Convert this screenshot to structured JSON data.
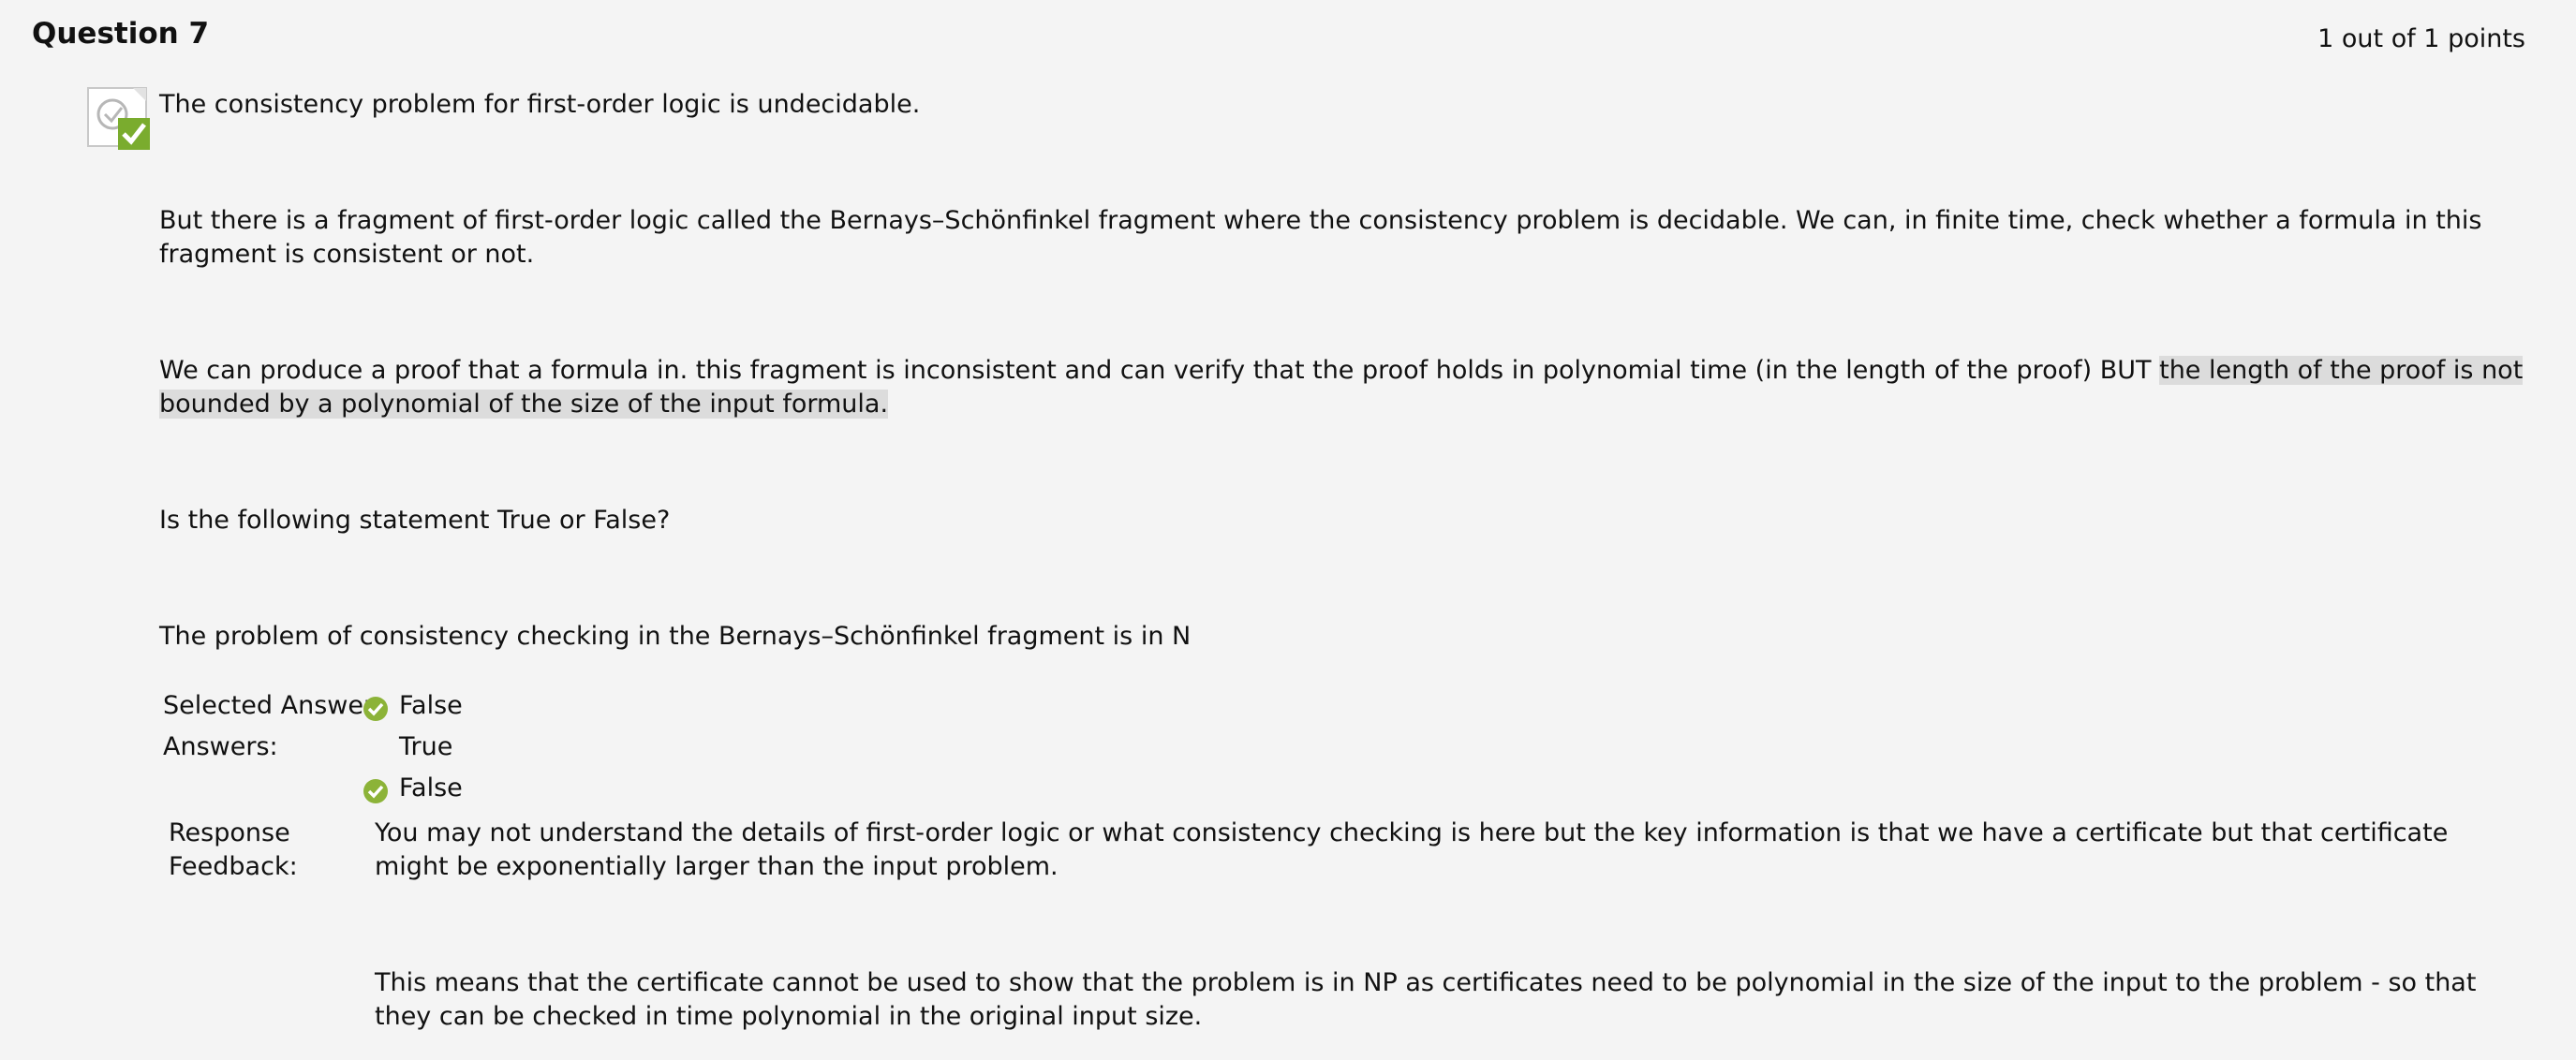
{
  "question": {
    "title": "Question 7",
    "points": "1 out of 1 points"
  },
  "body": {
    "p1": "The consistency problem for first-order logic is undecidable.",
    "p2": "But there is a fragment of first-order logic called the Bernays–Schönfinkel fragment where the consistency problem is decidable. We can, in finite time, check whether a formula in this fragment is consistent or not.",
    "p3_plain": "We can produce a proof that a formula in. this fragment is inconsistent and can verify that the proof holds in polynomial time (in the length of the proof) BUT ",
    "p3_highlight": "the length of the proof is not bounded by a polynomial of the size of the input formula.",
    "p4": "Is the following statement True or False?",
    "p5": "The problem of consistency checking in the Bernays–Schönfinkel fragment is in N"
  },
  "answers": {
    "selected_label": "Selected Answer:",
    "selected_value": "False",
    "answers_label": "Answers:",
    "options": [
      "True",
      "False"
    ]
  },
  "feedback": {
    "label": "Response Feedback:",
    "p1": "You may not understand the details of first-order logic or what consistency checking is here but the key information is that we have a certificate but that certificate might be exponentially larger than the input problem.",
    "p2": "This means that the certificate cannot be used to show that the problem is in NP as certificates need to be polynomial in the size of the input to the problem - so that they can be checked in time polynomial in the original input size."
  },
  "colors": {
    "background": "#f4f4f4",
    "correct_green": "#8cb338",
    "highlight": "#dcdcdc"
  },
  "icons": {
    "status": "correct-question-icon",
    "answer": "correct-check-icon"
  }
}
